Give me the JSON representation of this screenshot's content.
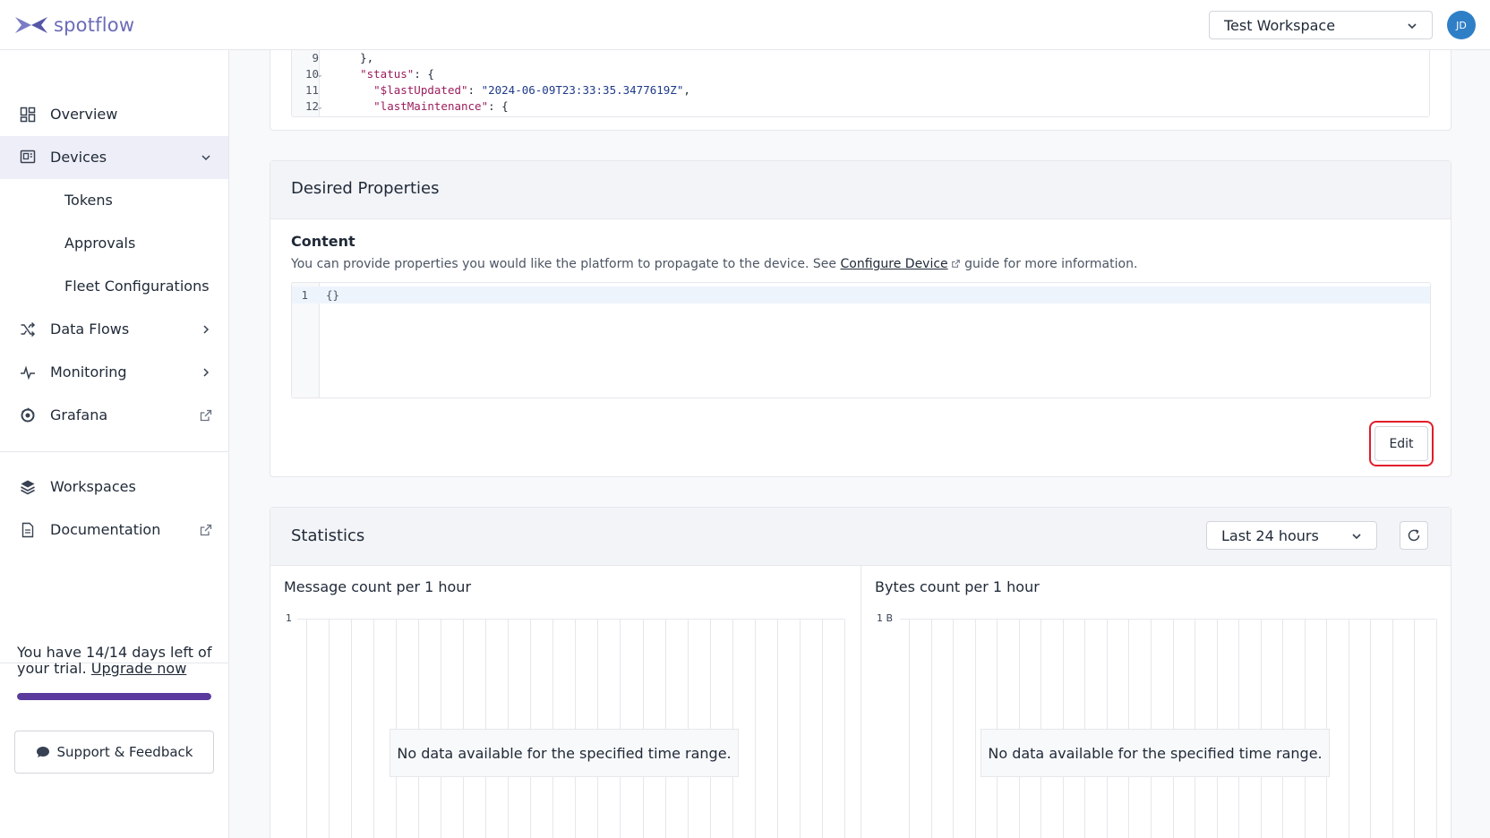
{
  "header": {
    "logo_text": "spotflow",
    "workspace": "Test Workspace",
    "avatar_initials": "JD"
  },
  "sidebar": {
    "items": [
      {
        "label": "Overview"
      },
      {
        "label": "Devices"
      },
      {
        "label": "Data Flows"
      },
      {
        "label": "Monitoring"
      },
      {
        "label": "Grafana"
      },
      {
        "label": "Workspaces"
      },
      {
        "label": "Documentation"
      }
    ],
    "sub_items": [
      {
        "label": "Tokens"
      },
      {
        "label": "Approvals"
      },
      {
        "label": "Fleet Configurations"
      }
    ],
    "trial_text": "You have 14/14 days left of your trial.",
    "upgrade_link": "Upgrade now",
    "trial_progress": 1.0,
    "support_label": "Support & Feedback"
  },
  "reported_code": {
    "lines": [
      {
        "n": "9",
        "text": "    },"
      },
      {
        "n": "10",
        "key": "\"status\"",
        "rest": ": {"
      },
      {
        "n": "11",
        "key": "\"$lastUpdated\"",
        "sep": ": ",
        "str": "\"2024-06-09T23:33:35.3477619Z\"",
        "tail": ","
      },
      {
        "n": "12",
        "key": "\"lastMaintenance\"",
        "rest": ": {"
      }
    ]
  },
  "desired": {
    "title": "Desired Properties",
    "content_label": "Content",
    "help_before": "You can provide properties you would like the platform to propagate to the device. See ",
    "help_link": "Configure Device",
    "help_after": " guide for more information.",
    "code_line_number": "1",
    "code_text": "{}",
    "edit_label": "Edit"
  },
  "statistics": {
    "title": "Statistics",
    "range": "Last 24 hours",
    "charts": [
      {
        "title": "Message count per 1 hour",
        "y_top": "1",
        "no_data": "No data available for the specified time range."
      },
      {
        "title": "Bytes count per 1 hour",
        "y_top": "1 B",
        "no_data": "No data available for the specified time range."
      }
    ]
  },
  "colors": {
    "accent": "#5b3a9e",
    "avatar": "#2f7fc7",
    "highlight_ring": "#e11d2a"
  }
}
